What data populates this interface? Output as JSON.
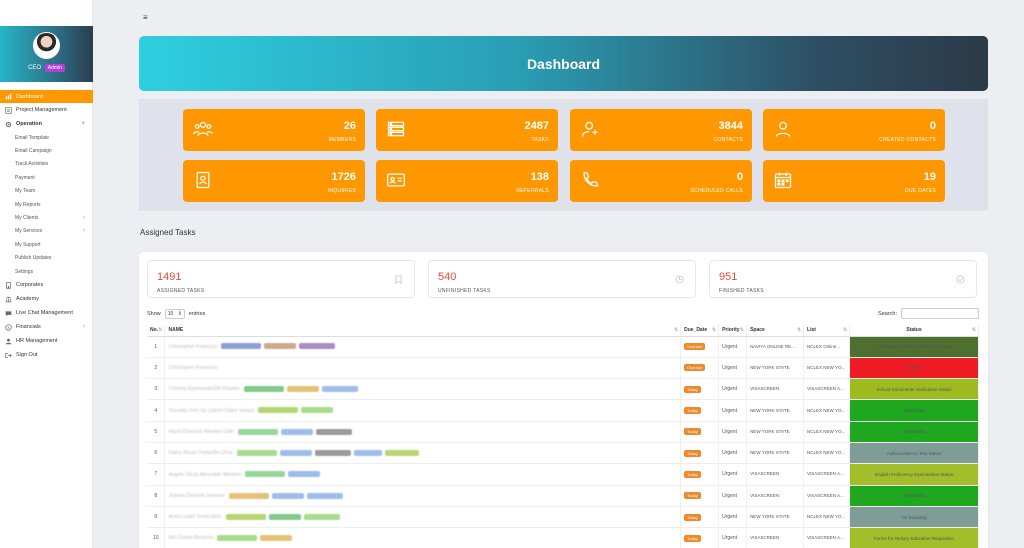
{
  "sidebar": {
    "role": "CEO",
    "badge": "Admin",
    "items": [
      {
        "label": "Dashboard",
        "icon": "chart-icon",
        "active": true
      },
      {
        "label": "Project Management",
        "icon": "project-icon"
      },
      {
        "label": "Operation",
        "icon": "gear-icon",
        "bold": true,
        "caret": "+"
      }
    ],
    "operation_subitems": [
      {
        "label": "Email Template"
      },
      {
        "label": "Email Campaign"
      },
      {
        "label": "Track Activities"
      },
      {
        "label": "Payment"
      },
      {
        "label": "My Team"
      },
      {
        "label": "My Reports"
      },
      {
        "label": "My Clients",
        "caret": "‹"
      },
      {
        "label": "My Services",
        "caret": "‹"
      },
      {
        "label": "My Support"
      },
      {
        "label": "Publish Updates"
      },
      {
        "label": "Settings"
      }
    ],
    "bottom_items": [
      {
        "label": "Corporates",
        "icon": "building-icon"
      },
      {
        "label": "Academy",
        "icon": "bank-icon"
      },
      {
        "label": "Live Chat Management",
        "icon": "chat-icon"
      },
      {
        "label": "Financials",
        "icon": "coin-icon",
        "caret": "‹"
      },
      {
        "label": "HR Management",
        "icon": "person-icon"
      },
      {
        "label": "Sign Out",
        "icon": "signout-icon"
      }
    ]
  },
  "header": {
    "menu_icon": "≡",
    "title": "Dashboard"
  },
  "stats": [
    {
      "value": "26",
      "label": "MEMBERS",
      "icon": "members-icon"
    },
    {
      "value": "2487",
      "label": "TASKS",
      "icon": "tasks-icon"
    },
    {
      "value": "3844",
      "label": "CONTACTS",
      "icon": "contacts-icon"
    },
    {
      "value": "0",
      "label": "CREATED CONTACTS",
      "icon": "user-icon"
    },
    {
      "value": "1726",
      "label": "INQUIRIES",
      "icon": "inquiry-icon"
    },
    {
      "value": "138",
      "label": "REFERRALS",
      "icon": "id-card-icon"
    },
    {
      "value": "0",
      "label": "SCHEDULED CALLS",
      "icon": "phone-icon"
    },
    {
      "value": "19",
      "label": "DUE DATES",
      "icon": "calendar-icon"
    }
  ],
  "assigned": {
    "title": "Assigned Tasks",
    "summary": [
      {
        "value": "1491",
        "label": "ASSIGNED TASKS",
        "icon": "bookmark-icon"
      },
      {
        "value": "540",
        "label": "UNFINISHED TASKS",
        "icon": "clock-icon"
      },
      {
        "value": "951",
        "label": "FINISHED TASKS",
        "icon": "check-circle-icon"
      }
    ],
    "show_label": "Show",
    "entries_value": "10",
    "entries_label": "entries",
    "search_label": "Search:",
    "columns": [
      "No.",
      "NAME",
      "Due_Date",
      "Priority",
      "Space",
      "List",
      "Status"
    ],
    "rows": [
      {
        "no": "1",
        "name": "Christopher Francisco",
        "tags": [
          "#7b8fc9",
          "#c49b7b",
          "#9b7bb4"
        ],
        "due": "Overdue",
        "priority": "Urgent",
        "space": "NAVIYA ONLINE RE...",
        "list": "NCLEX Online...",
        "status": "Calibration and One on One Coaching",
        "status_color": "#4f6f2f"
      },
      {
        "no": "2",
        "name": "Christopher Francisco",
        "tags": [],
        "due": "Overdue",
        "priority": "Urgent",
        "space": "NEW YORK STATE",
        "list": "NCLEX NEW YO...",
        "status": "Closed",
        "status_color": "#ee1c25"
      },
      {
        "no": "3",
        "name": "Crissela Raymundo/Del Rosario",
        "tags": [
          "#6cc07a",
          "#e0b860",
          "#8fb2e8"
        ],
        "due": "Today",
        "priority": "Urgent",
        "space": "VISASCREEN",
        "list": "VISASCREEN A...",
        "status": "School Documents Verification Status",
        "status_color": "#9dbb1e"
      },
      {
        "no": "4",
        "name": "Seoodity Fort Sty Libeml Dates Senios",
        "tags": [
          "#aacf5a",
          "#9bd67a"
        ],
        "due": "Today",
        "priority": "Urgent",
        "space": "NEW YORK STATE",
        "list": "NCLEX NEW YO...",
        "status": "Application",
        "status_color": "#1fa81f"
      },
      {
        "no": "5",
        "name": "Hazel Ebecrore Abedles Gille",
        "tags": [
          "#86cf86",
          "#8fb2e8",
          "#8a8a8a"
        ],
        "due": "Today",
        "priority": "Urgent",
        "space": "NEW YORK STATE",
        "list": "NCLEX NEW YO...",
        "status": "Application",
        "status_color": "#1fa81f"
      },
      {
        "no": "6",
        "name": "Diana Rousn Fortanillo Chua",
        "tags": [
          "#9bd67a",
          "#8fb2e8",
          "#8a8a8a",
          "#8fb2e8",
          "#aacf5a"
        ],
        "due": "Today",
        "priority": "Urgent",
        "space": "NEW YORK STATE",
        "list": "NCLEX NEW YO...",
        "status": "Authorization to Test Status",
        "status_color": "#7f9d96"
      },
      {
        "no": "7",
        "name": "Angelic Ricas Abroodde Montero",
        "tags": [
          "#86cf86",
          "#8fb2e8"
        ],
        "due": "Today",
        "priority": "Urgent",
        "space": "VISASCREEN",
        "list": "VISASCREEN A...",
        "status": "English Proficiency Examination Status",
        "status_color": "#a4bd2a"
      },
      {
        "no": "8",
        "name": "Joanna Duclarta Setunas",
        "tags": [
          "#e0b860",
          "#8fb2e8",
          "#8fb2e8"
        ],
        "due": "Today",
        "priority": "Urgent",
        "space": "VISASCREEN",
        "list": "VISASCREEN A...",
        "status": "Application",
        "status_color": "#1fa81f"
      },
      {
        "no": "9",
        "name": "Anna Lisiad Yonist Alelu",
        "tags": [
          "#aacf5a",
          "#6cc07a",
          "#9bd67a"
        ],
        "due": "Today",
        "priority": "Urgent",
        "space": "NEW YORK STATE",
        "list": "NCLEX NEW YO...",
        "status": "On Boarding",
        "status_color": "#7f9d96"
      },
      {
        "no": "10",
        "name": "Mici Dirsdo Bedonia",
        "tags": [
          "#9bd67a",
          "#e0b860"
        ],
        "due": "Today",
        "priority": "Urgent",
        "space": "VISASCREEN",
        "list": "VISASCREEN A...",
        "status": "Forms for Tertiary Education Requisition",
        "status_color": "#a4bd2a"
      }
    ]
  }
}
